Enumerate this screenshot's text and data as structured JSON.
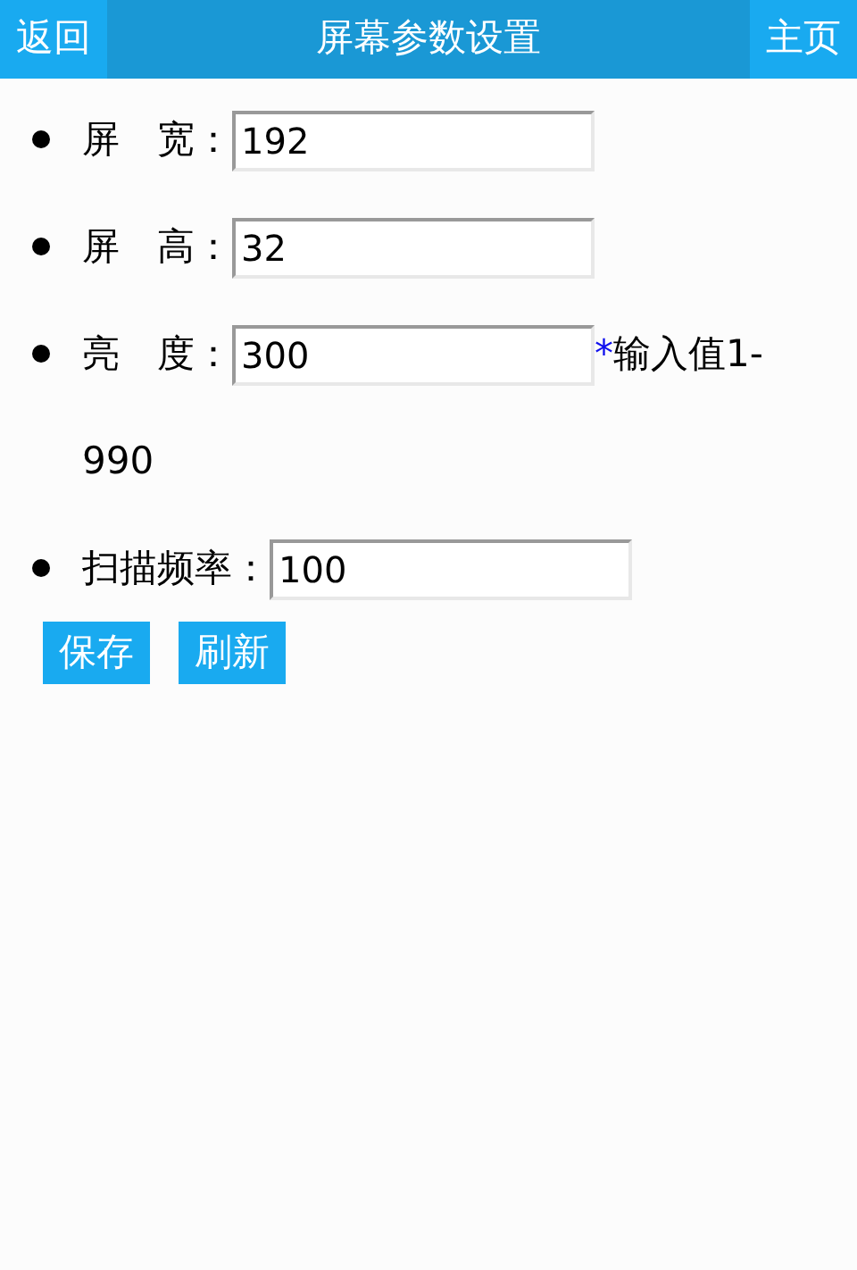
{
  "header": {
    "back": "返回",
    "title": "屏幕参数设置",
    "home": "主页"
  },
  "fields": [
    {
      "label": "屏　宽：",
      "value": "192"
    },
    {
      "label": "屏　高：",
      "value": "32"
    },
    {
      "label": "亮　度：",
      "value": "300",
      "required_mark": "*",
      "hint_lines": [
        "输入值1-",
        "990"
      ]
    },
    {
      "label": "扫描频率：",
      "value": "100"
    }
  ],
  "buttons": [
    "保存",
    "刷新"
  ]
}
